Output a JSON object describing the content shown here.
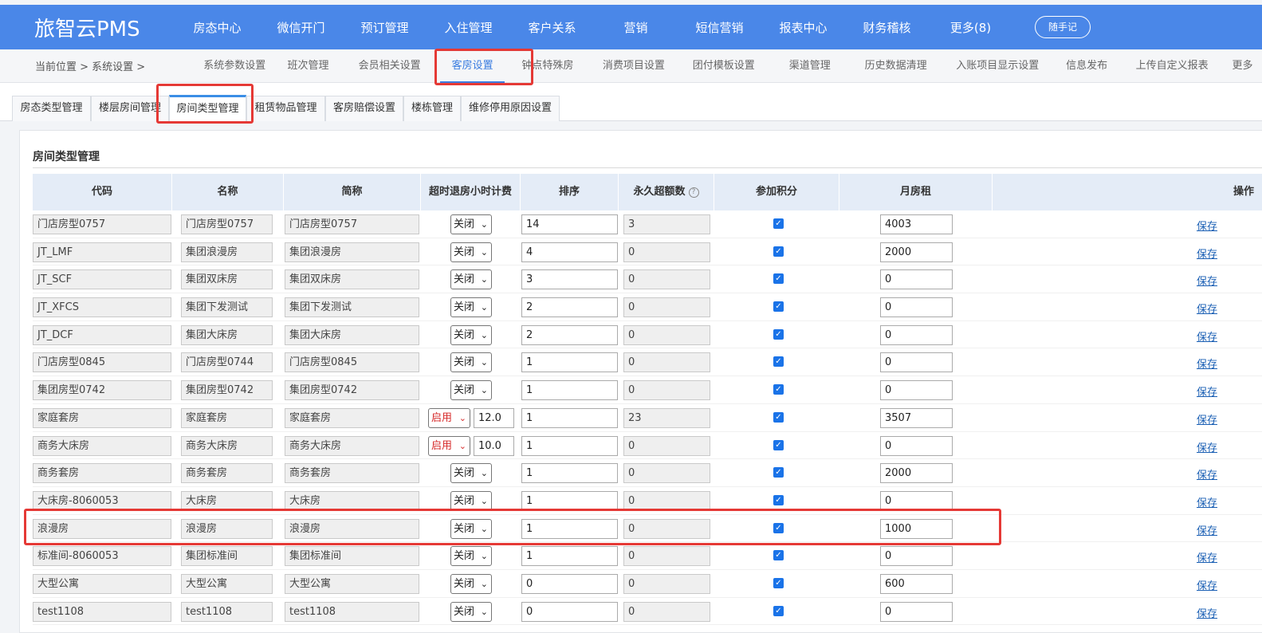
{
  "app": {
    "brand": "旅智云PMS",
    "memo_button": "随手记"
  },
  "nav": [
    "房态中心",
    "微信开门",
    "预订管理",
    "入住管理",
    "客户关系",
    "营销",
    "短信营销",
    "报表中心",
    "财务稽核",
    "更多(8)"
  ],
  "breadcrumb": "当前位置 > 系统设置 >",
  "subnav": [
    "系统参数设置",
    "班次管理",
    "会员相关设置",
    "客房设置",
    "钟点特殊房",
    "消费项目设置",
    "团付模板设置",
    "渠道管理",
    "历史数据清理",
    "入账项目显示设置",
    "信息发布",
    "上传自定义报表",
    "更多"
  ],
  "subnav_active": "客房设置",
  "tabs": [
    "房态类型管理",
    "楼层房间管理",
    "房间类型管理",
    "租赁物品管理",
    "客房赔偿设置",
    "楼栋管理",
    "维修停用原因设置"
  ],
  "tab_active": "房间类型管理",
  "section_title": "房间类型管理",
  "columns": [
    "代码",
    "名称",
    "简称",
    "超时退房小时计费",
    "排序",
    "永久超额数",
    "参加积分",
    "月房租",
    "操作"
  ],
  "help_icon": "?",
  "save_label": "保存",
  "rows": [
    {
      "code": "门店房型0757",
      "name": "门店房型0757",
      "short": "门店房型0757",
      "billing": "关闭",
      "hours": "",
      "sort": "14",
      "excess": "3",
      "points": true,
      "rent": "4003"
    },
    {
      "code": "JT_LMF",
      "name": "集团浪漫房",
      "short": "集团浪漫房",
      "billing": "关闭",
      "hours": "",
      "sort": "4",
      "excess": "0",
      "points": true,
      "rent": "2000"
    },
    {
      "code": "JT_SCF",
      "name": "集团双床房",
      "short": "集团双床房",
      "billing": "关闭",
      "hours": "",
      "sort": "3",
      "excess": "0",
      "points": true,
      "rent": "0"
    },
    {
      "code": "JT_XFCS",
      "name": "集团下发测试",
      "short": "集团下发测试",
      "billing": "关闭",
      "hours": "",
      "sort": "2",
      "excess": "0",
      "points": true,
      "rent": "0"
    },
    {
      "code": "JT_DCF",
      "name": "集团大床房",
      "short": "集团大床房",
      "billing": "关闭",
      "hours": "",
      "sort": "2",
      "excess": "0",
      "points": true,
      "rent": "0"
    },
    {
      "code": "门店房型0845",
      "name": "门店房型0744",
      "short": "门店房型0845",
      "billing": "关闭",
      "hours": "",
      "sort": "1",
      "excess": "0",
      "points": true,
      "rent": "0"
    },
    {
      "code": "集团房型0742",
      "name": "集团房型0742",
      "short": "集团房型0742",
      "billing": "关闭",
      "hours": "",
      "sort": "1",
      "excess": "0",
      "points": true,
      "rent": "0"
    },
    {
      "code": "家庭套房",
      "name": "家庭套房",
      "short": "家庭套房",
      "billing": "启用",
      "hours": "12.0",
      "sort": "1",
      "excess": "23",
      "points": true,
      "rent": "3507"
    },
    {
      "code": "商务大床房",
      "name": "商务大床房",
      "short": "商务大床房",
      "billing": "启用",
      "hours": "10.0",
      "sort": "1",
      "excess": "0",
      "points": true,
      "rent": "0"
    },
    {
      "code": "商务套房",
      "name": "商务套房",
      "short": "商务套房",
      "billing": "关闭",
      "hours": "",
      "sort": "1",
      "excess": "0",
      "points": true,
      "rent": "2000"
    },
    {
      "code": "大床房-8060053",
      "name": "大床房",
      "short": "大床房",
      "billing": "关闭",
      "hours": "",
      "sort": "1",
      "excess": "0",
      "points": true,
      "rent": "0"
    },
    {
      "code": "浪漫房",
      "name": "浪漫房",
      "short": "浪漫房",
      "billing": "关闭",
      "hours": "",
      "sort": "1",
      "excess": "0",
      "points": true,
      "rent": "1000"
    },
    {
      "code": "标准间-8060053",
      "name": "集团标准间",
      "short": "集团标准间",
      "billing": "关闭",
      "hours": "",
      "sort": "1",
      "excess": "0",
      "points": true,
      "rent": "0"
    },
    {
      "code": "大型公寓",
      "name": "大型公寓",
      "short": "大型公寓",
      "billing": "关闭",
      "hours": "",
      "sort": "0",
      "excess": "0",
      "points": true,
      "rent": "600"
    },
    {
      "code": "test1108",
      "name": "test1108",
      "short": "test1108",
      "billing": "关闭",
      "hours": "",
      "sort": "0",
      "excess": "0",
      "points": true,
      "rent": "0"
    }
  ],
  "colors": {
    "nav_bg": "#4a87e8",
    "active_link": "#3b7de0",
    "annotation": "#e53935",
    "enabled_select": "#d62b2b"
  }
}
